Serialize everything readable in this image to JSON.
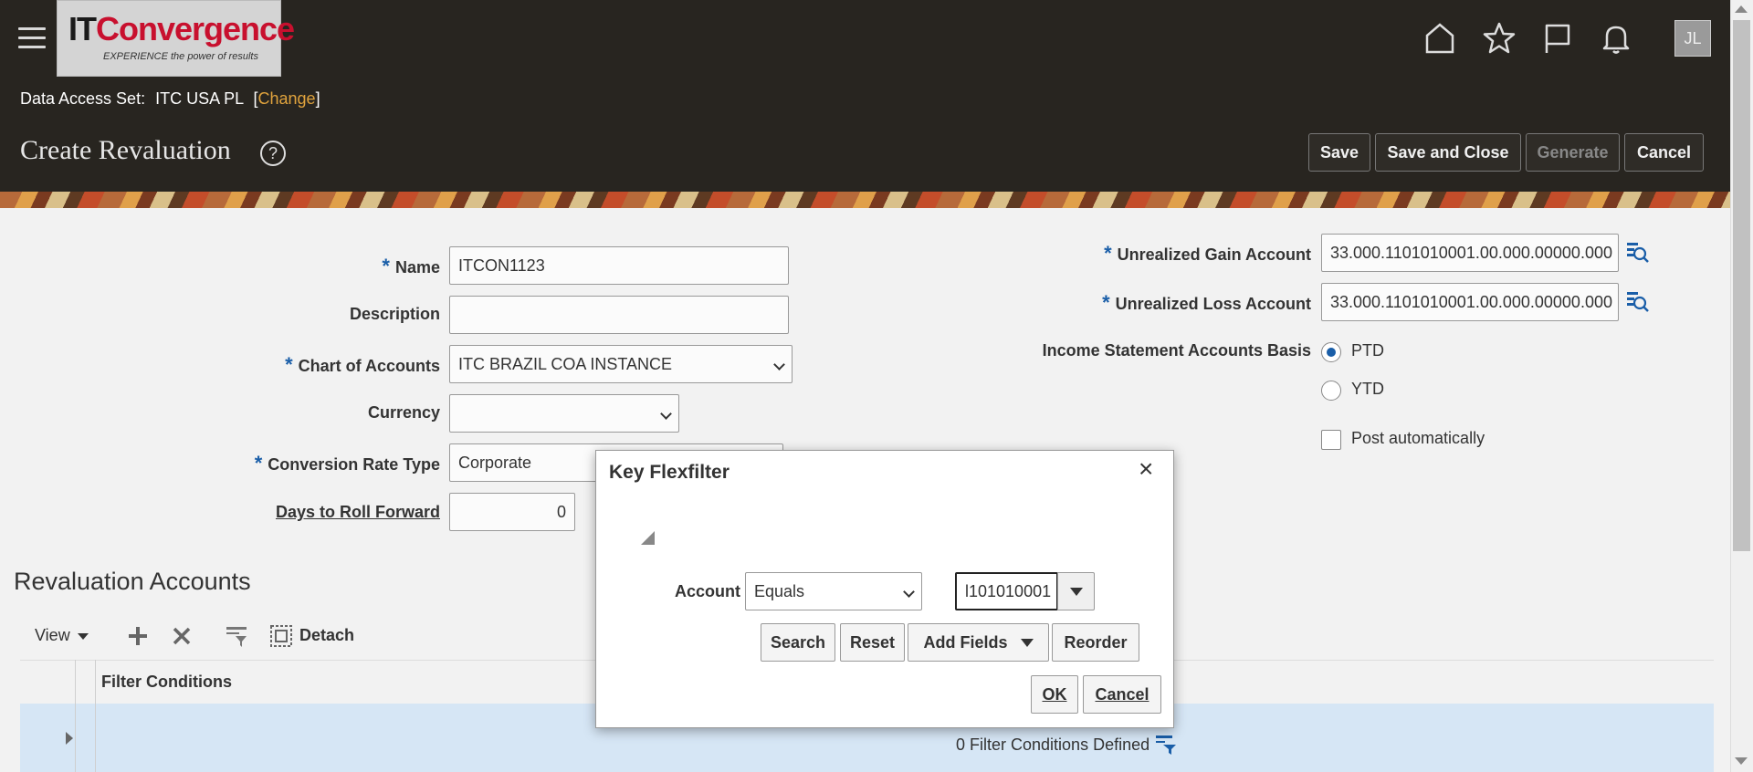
{
  "header": {
    "logo_it": "IT",
    "logo_rest": "Convergence",
    "logo_tagline": "EXPERIENCE the power of results",
    "avatar_initials": "JL",
    "data_access_label": "Data Access Set:",
    "data_access_value": "ITC USA PL",
    "change_open": "[",
    "change_link": "Change",
    "change_close": "]",
    "page_title": "Create Revaluation",
    "help_glyph": "?",
    "buttons": {
      "save": "Save",
      "save_close": "Save and Close",
      "generate": "Generate",
      "cancel": "Cancel"
    }
  },
  "form": {
    "name_label": "Name",
    "name_value": "ITCON1123",
    "description_label": "Description",
    "description_value": "",
    "coa_label": "Chart of Accounts",
    "coa_value": "ITC BRAZIL COA INSTANCE",
    "currency_label": "Currency",
    "currency_value": "",
    "rate_type_label": "Conversion Rate Type",
    "rate_type_value": "Corporate",
    "days_label": "Days to Roll Forward",
    "days_value": "0",
    "gain_label": "Unrealized Gain Account",
    "gain_value": "33.000.1101010001.00.000.00000.000",
    "loss_label": "Unrealized Loss Account",
    "loss_value": "33.000.1101010001.00.000.00000.000",
    "basis_label": "Income Statement Accounts Basis",
    "basis_options": [
      "PTD",
      "YTD"
    ],
    "basis_selected": "PTD",
    "post_auto_label": "Post automatically",
    "post_auto_checked": false
  },
  "revaluation": {
    "title": "Revaluation Accounts",
    "view_label": "View",
    "detach_label": "Detach",
    "column_filter": "Filter Conditions",
    "row_filter_summary": "0 Filter Conditions Defined"
  },
  "dialog": {
    "title": "Key Flexfilter",
    "close_glyph": "×",
    "account_label": "Account",
    "operator_value": "Equals",
    "account_value": "l101010001",
    "buttons": {
      "search": "Search",
      "reset": "Reset",
      "add_fields": "Add Fields",
      "reorder": "Reorder",
      "ok": "OK",
      "cancel": "Cancel"
    }
  },
  "colors": {
    "header_bg": "#282520",
    "accent_blue": "#1a5ea8",
    "link_orange": "#e0a33d",
    "selected_row": "#d6e6f5"
  }
}
